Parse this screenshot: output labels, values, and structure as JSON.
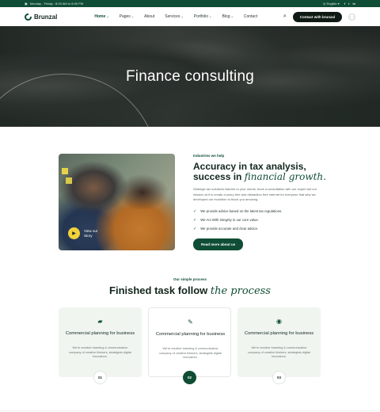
{
  "topbar": {
    "date": "Monday - Friday : 8:00 AM to 6:00 PM",
    "language": "English",
    "socials": [
      "f",
      "t",
      "in"
    ]
  },
  "nav": {
    "logo": "Brunzal",
    "items": [
      "Home",
      "Pages",
      "About",
      "Services",
      "Portfolio",
      "Blog",
      "Contact"
    ],
    "cta": "Contact with brunzal"
  },
  "hero": {
    "title": "Finance consulting"
  },
  "about": {
    "video_label": "View our Story",
    "eyebrow": "Industries we help",
    "title_plain": "Accuracy in tax analysis, success in ",
    "title_accent": "financial growth.",
    "desc": "Strategic tax solutions tailored to your needs, book a consultation with our expert set our mission at it is create a worry free and distraction free internet for everyone that why we developed our evolution to block you amusing.",
    "checks": [
      "We provide advice based on the latest tax regulations.",
      "We Act With integrity in our core value.",
      "We provide accurate and clear advice."
    ],
    "button": "Read more about us"
  },
  "process": {
    "eyebrow": "Our simple process",
    "title_plain": "Finished task follow ",
    "title_accent": "the process",
    "cards": [
      {
        "title": "Commercial planning for business",
        "desc": "We're creative branding & communication company of creative thinkers, strategists digital innovators.",
        "num": "01",
        "icon": "briefcase-icon"
      },
      {
        "title": "Commercial planning for business",
        "desc": "We're creative branding & communication company of creative thinkers, strategists digital innovators.",
        "num": "02",
        "icon": "pen-icon"
      },
      {
        "title": "Commercial planning for business",
        "desc": "We're creative branding & communication company of creative thinkers, strategists digital innovators.",
        "num": "03",
        "icon": "coins-icon"
      }
    ]
  },
  "colors": {
    "brand": "#0f4d34",
    "card_bg": "#f0f5f0",
    "accent_yellow": "#f2d23b"
  }
}
